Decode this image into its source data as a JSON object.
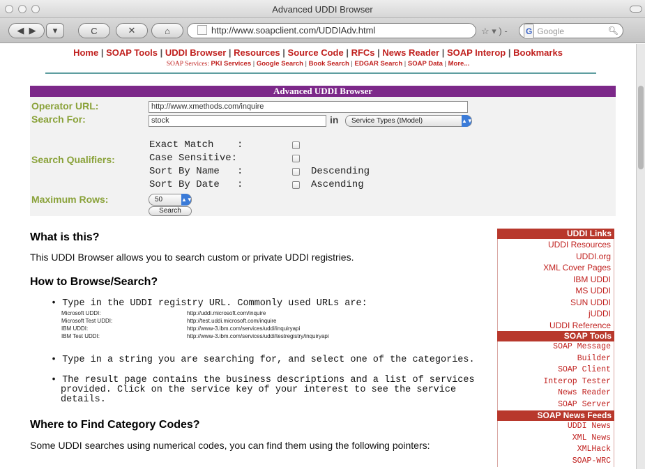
{
  "window": {
    "title": "Advanced UDDI Browser",
    "url": "http://www.soapclient.com/UDDIAdv.html",
    "search_engine_badge": "G",
    "search_placeholder": "Google"
  },
  "nav": {
    "top": [
      "Home",
      "SOAP Tools",
      "UDDI Browser",
      "Resources",
      "Source Code",
      "RFCs",
      "News Reader",
      "SOAP Interop",
      "Bookmarks"
    ],
    "sub_label": "SOAP Services:",
    "sub": [
      "PKI Services",
      "Google Search",
      "Book Search",
      "EDGAR Search",
      "SOAP Data",
      "More..."
    ]
  },
  "form": {
    "title": "Advanced UDDI Browser",
    "operator_label": "Operator URL:",
    "operator_value": "http://www.xmethods.com/inquire",
    "search_label": "Search For:",
    "search_value": "stock",
    "in_word": "in",
    "search_type": "Service Types (tModel)",
    "qualifiers_label": "Search Qualifiers:",
    "qualifiers": [
      {
        "label": "Exact Match    :",
        "suffix": ""
      },
      {
        "label": "Case Sensitive:",
        "suffix": ""
      },
      {
        "label": "Sort By Name   :",
        "suffix": "Descending"
      },
      {
        "label": "Sort By Date   :",
        "suffix": "Ascending"
      }
    ],
    "max_rows_label": "Maximum Rows:",
    "max_rows_value": "50",
    "search_button": "Search"
  },
  "content": {
    "what_title": "What is this?",
    "what_text": "This UDDI Browser allows you to search custom or private UDDI registries.",
    "how_title": "How to Browse/Search?",
    "bullet1": "Type in the UDDI registry URL. Commonly used URLs are:",
    "registries": [
      {
        "name": "Microsoft UDDI:",
        "url": "http://uddi.microsoft.com/inquire"
      },
      {
        "name": "Microsoft Test UDDI:",
        "url": "http://test.uddi.microsoft.com/inquire"
      },
      {
        "name": "IBM UDDI:",
        "url": "http://www-3.ibm.com/services/uddi/inquiryapi"
      },
      {
        "name": "IBM Test UDDI:",
        "url": "http://www-3.ibm.com/services/uddi/testregistry/inquiryapi"
      }
    ],
    "bullet2": "Type in a string you are searching for, and select one of the categories.",
    "bullet3": "The result page contains the business descriptions and a list of services provided. Click on the service key of your interest to see the service details.",
    "where_title": "Where to Find Category Codes?",
    "where_text": "Some UDDI searches using numerical codes, you can find them using the following pointers:"
  },
  "sidebar": {
    "sections": [
      {
        "title": "UDDI Links",
        "mono": false,
        "items": [
          "UDDI Resources",
          "UDDI.org",
          "XML Cover Pages",
          "IBM UDDI",
          "MS UDDI",
          "SUN UDDI",
          "jUDDI",
          "UDDI Reference"
        ]
      },
      {
        "title": "SOAP Tools",
        "mono": true,
        "items": [
          "SOAP Message",
          "Builder",
          "SOAP Client",
          "Interop Tester",
          "News Reader",
          "SOAP Server"
        ]
      },
      {
        "title": "SOAP News Feeds",
        "mono": true,
        "items": [
          "UDDI News",
          "XML News",
          "XMLHack",
          "SOAP-WRC"
        ]
      }
    ]
  }
}
